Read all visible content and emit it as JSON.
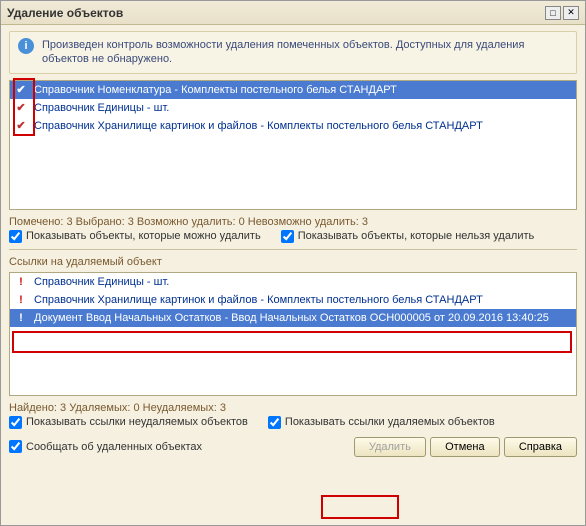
{
  "title": "Удаление объектов",
  "info": "Произведен контроль возможности удаления помеченных объектов. Доступных для удаления объектов не обнаружено.",
  "topList": [
    {
      "icon": "check",
      "text": "Справочник Номенклатура - Комплекты постельного белья СТАНДАРТ",
      "selected": true
    },
    {
      "icon": "check",
      "text": "Справочник Единицы - шт.",
      "selected": false
    },
    {
      "icon": "check",
      "text": "Справочник Хранилище картинок и файлов - Комплекты постельного белья СТАНДАРТ",
      "selected": false
    }
  ],
  "status1": "Помечено: 3  Выбрано: 3  Возможно удалить: 0  Невозможно удалить: 3",
  "chk1a": "Показывать объекты, которые можно удалить",
  "chk1b": "Показывать объекты, которые нельзя удалить",
  "midLabel": "Ссылки на удаляемый объект",
  "midList": [
    {
      "icon": "exclaim",
      "text": "Справочник Единицы - шт.",
      "selected": false
    },
    {
      "icon": "exclaim",
      "text": "Справочник Хранилище картинок и файлов - Комплекты постельного белья СТАНДАРТ",
      "selected": false
    },
    {
      "icon": "exclaim",
      "text": "Документ Ввод Начальных Остатков - Ввод Начальных Остатков ОСН000005 от 20.09.2016 13:40:25",
      "selected": true
    }
  ],
  "status2": "Найдено: 3  Удаляемых: 0  Неудаляемых: 3",
  "chk2a": "Показывать ссылки неудаляемых объектов",
  "chk2b": "Показывать ссылки удаляемых объектов",
  "chk2c": "Сообщать об удаленных объектах",
  "btnDelete": "Удалить",
  "btnCancel": "Отмена",
  "btnHelp": "Справка"
}
